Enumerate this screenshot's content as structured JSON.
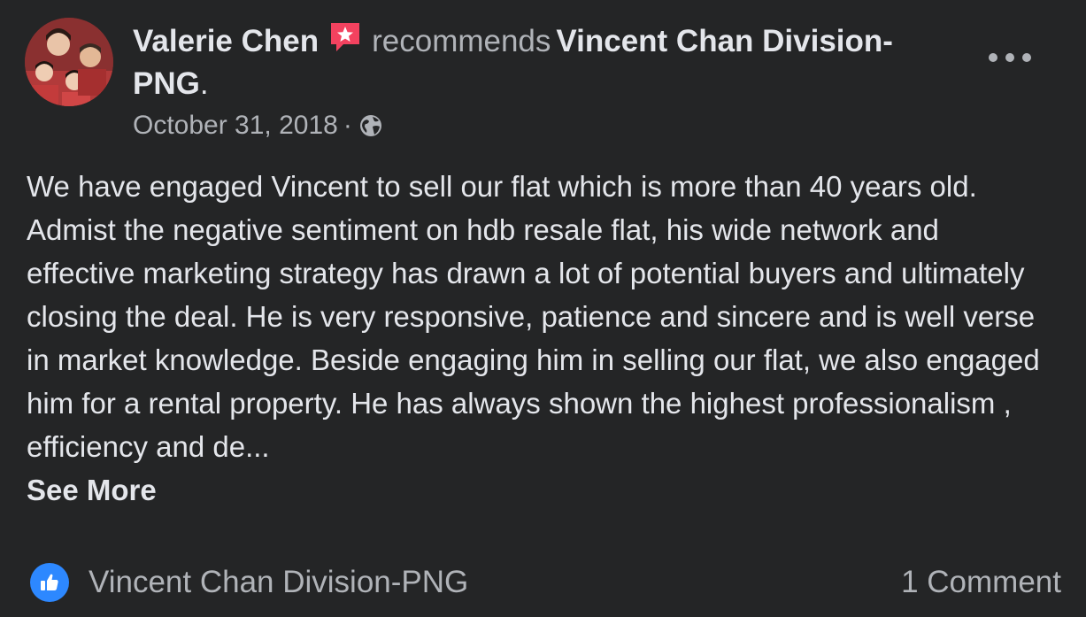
{
  "author": {
    "name": "Valerie Chen",
    "action": "recommends",
    "page_name": "Vincent Chan Division-PNG",
    "punctuation": "."
  },
  "meta": {
    "date": "October 31, 2018",
    "separator": "·",
    "audience_icon": "globe-icon"
  },
  "post": {
    "text": "We have engaged Vincent to sell our flat which is more than 40 years old. Admist the negative sentiment on hdb resale flat, his wide network and effective marketing strategy has drawn a lot of potential buyers and ultimately closing the deal. He is very responsive, patience and sincere and is well verse in market knowledge. Beside engaging him in selling our flat, we also engaged him for a rental property.  He has always shown the highest professionalism ,  efficiency and de...",
    "see_more": "See More"
  },
  "footer": {
    "page_name": "Vincent Chan Division-PNG",
    "comments": "1 Comment"
  },
  "colors": {
    "background": "#242526",
    "primary_text": "#e4e6eb",
    "secondary_text": "#b0b3b8",
    "like_blue": "#2d88ff",
    "badge_pink": "#f3425f"
  }
}
